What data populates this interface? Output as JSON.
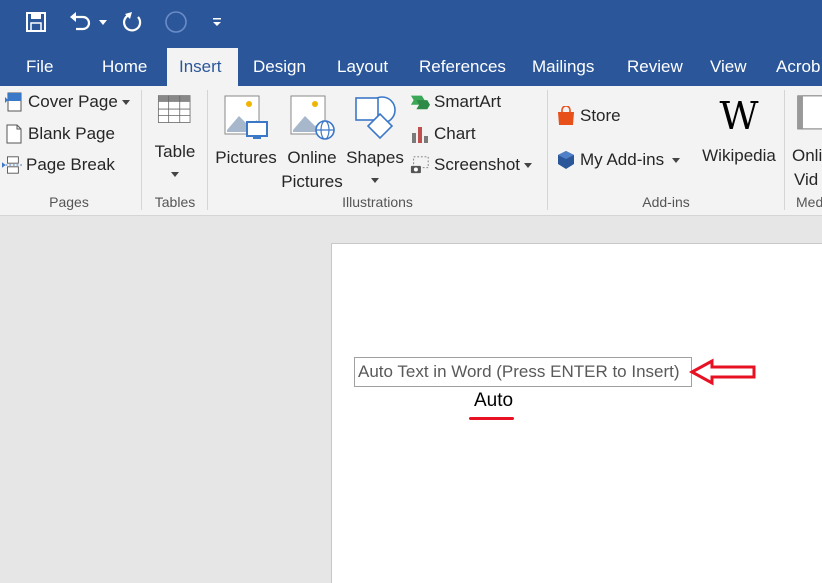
{
  "quick_access": {
    "icons": [
      "save-icon",
      "undo-icon",
      "redo-icon",
      "touch-mode-icon",
      "customize-qat-icon"
    ]
  },
  "tabs": [
    "File",
    "Home",
    "Insert",
    "Design",
    "Layout",
    "References",
    "Mailings",
    "Review",
    "View",
    "Acrob"
  ],
  "active_tab": "Insert",
  "ribbon": {
    "pages": {
      "cover_page": "Cover Page",
      "blank_page": "Blank Page",
      "page_break": "Page Break",
      "label": "Pages"
    },
    "tables": {
      "table": "Table",
      "label": "Tables"
    },
    "illustrations": {
      "pictures": "Pictures",
      "online_pictures_1": "Online",
      "online_pictures_2": "Pictures",
      "shapes": "Shapes",
      "smartart": "SmartArt",
      "chart": "Chart",
      "screenshot": "Screenshot",
      "label": "Illustrations"
    },
    "addins": {
      "store": "Store",
      "my_addins": "My Add-ins",
      "wikipedia": "Wikipedia",
      "label": "Add-ins"
    },
    "media": {
      "online_video_1": "Onli",
      "online_video_2": "Vid",
      "label": "Med"
    }
  },
  "document": {
    "autotext_tip": "Auto Text in Word  (Press ENTER to Insert)",
    "typed_text": "Auto"
  },
  "colors": {
    "brand": "#2b579a",
    "annotation_arrow": "#e81123"
  }
}
